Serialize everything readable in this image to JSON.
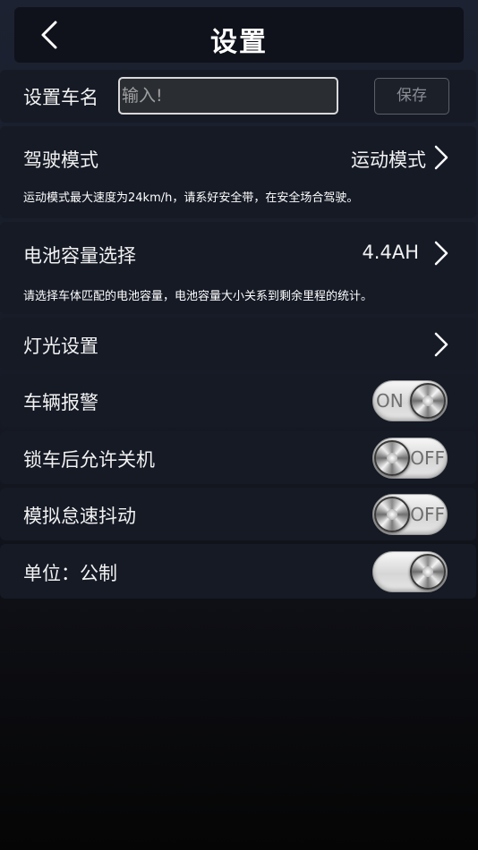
{
  "header": {
    "title": "设置",
    "back_icon": "chevron-left-icon"
  },
  "name_row": {
    "label": "设置车名",
    "input_placeholder": "输入!",
    "input_value": "",
    "save_label": "保存"
  },
  "drive_mode": {
    "label": "驾驶模式",
    "value": "运动模式",
    "description": "运动模式最大速度为24km/h，请系好安全带，在安全场合驾驶。"
  },
  "battery": {
    "label": "电池容量选择",
    "value": "4.4AH",
    "description": "请选择车体匹配的电池容量，电池容量大小关系到剩余里程的统计。"
  },
  "lights": {
    "label": "灯光设置"
  },
  "toggles": [
    {
      "label": "车辆报警",
      "state": "ON",
      "text": "ON"
    },
    {
      "label": "锁车后允许关机",
      "state": "OFF",
      "text": "OFF"
    },
    {
      "label": "模拟怠速抖动",
      "state": "OFF",
      "text": "OFF"
    },
    {
      "label": "单位：公制",
      "state": "ON",
      "text": ""
    }
  ],
  "colors": {
    "background": "#1c2231",
    "row": "#151a25",
    "header": "#0f121b"
  }
}
